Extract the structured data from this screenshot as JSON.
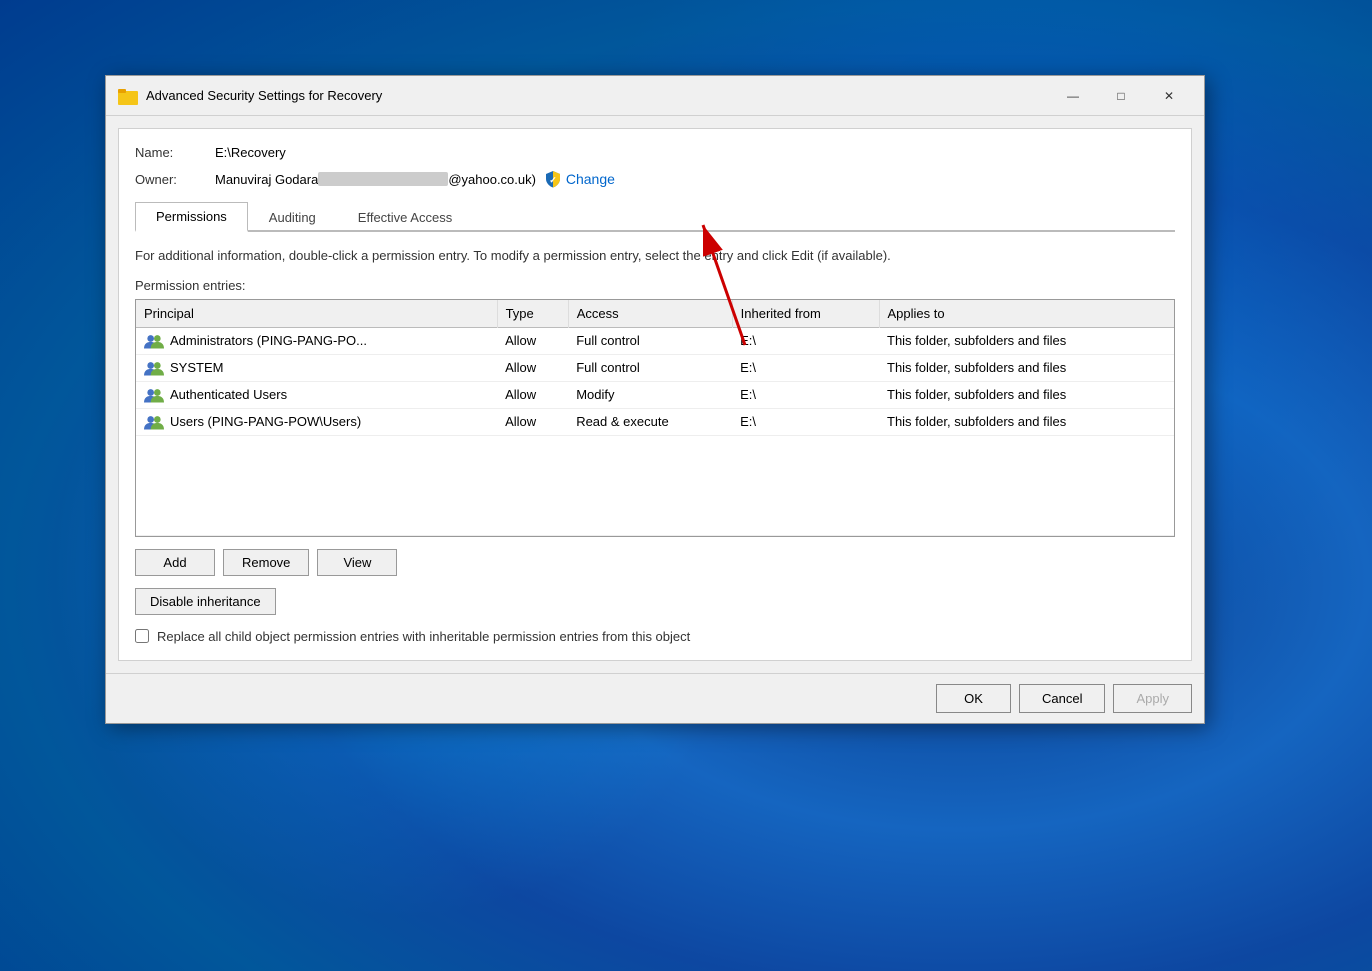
{
  "window": {
    "title": "Advanced Security Settings for Recovery",
    "folder_icon": "folder"
  },
  "title_controls": {
    "minimize": "—",
    "maximize": "□",
    "close": "✕"
  },
  "info": {
    "name_label": "Name:",
    "name_value": "E:\\Recovery",
    "owner_label": "Owner:",
    "owner_name": "Manuviraj Godara ",
    "owner_email_suffix": "@yahoo.co.uk)",
    "change_label": "Change"
  },
  "tabs": [
    {
      "id": "permissions",
      "label": "Permissions",
      "active": true
    },
    {
      "id": "auditing",
      "label": "Auditing",
      "active": false
    },
    {
      "id": "effective_access",
      "label": "Effective Access",
      "active": false
    }
  ],
  "description": "For additional information, double-click a permission entry. To modify a permission entry, select the entry and click Edit (if available).",
  "section_label": "Permission entries:",
  "table": {
    "headers": [
      "Principal",
      "Type",
      "Access",
      "Inherited from",
      "Applies to"
    ],
    "rows": [
      {
        "principal": "Administrators (PING-PANG-PO...",
        "type": "Allow",
        "access": "Full control",
        "inherited_from": "E:\\",
        "applies_to": "This folder, subfolders and files"
      },
      {
        "principal": "SYSTEM",
        "type": "Allow",
        "access": "Full control",
        "inherited_from": "E:\\",
        "applies_to": "This folder, subfolders and files"
      },
      {
        "principal": "Authenticated Users",
        "type": "Allow",
        "access": "Modify",
        "inherited_from": "E:\\",
        "applies_to": "This folder, subfolders and files"
      },
      {
        "principal": "Users (PING-PANG-POW\\Users)",
        "type": "Allow",
        "access": "Read & execute",
        "inherited_from": "E:\\",
        "applies_to": "This folder, subfolders and files"
      }
    ]
  },
  "buttons": {
    "add": "Add",
    "remove": "Remove",
    "view": "View",
    "disable_inheritance": "Disable inheritance"
  },
  "checkbox": {
    "label": "Replace all child object permission entries with inheritable permission entries from this object"
  },
  "footer": {
    "ok": "OK",
    "cancel": "Cancel",
    "apply": "Apply"
  }
}
